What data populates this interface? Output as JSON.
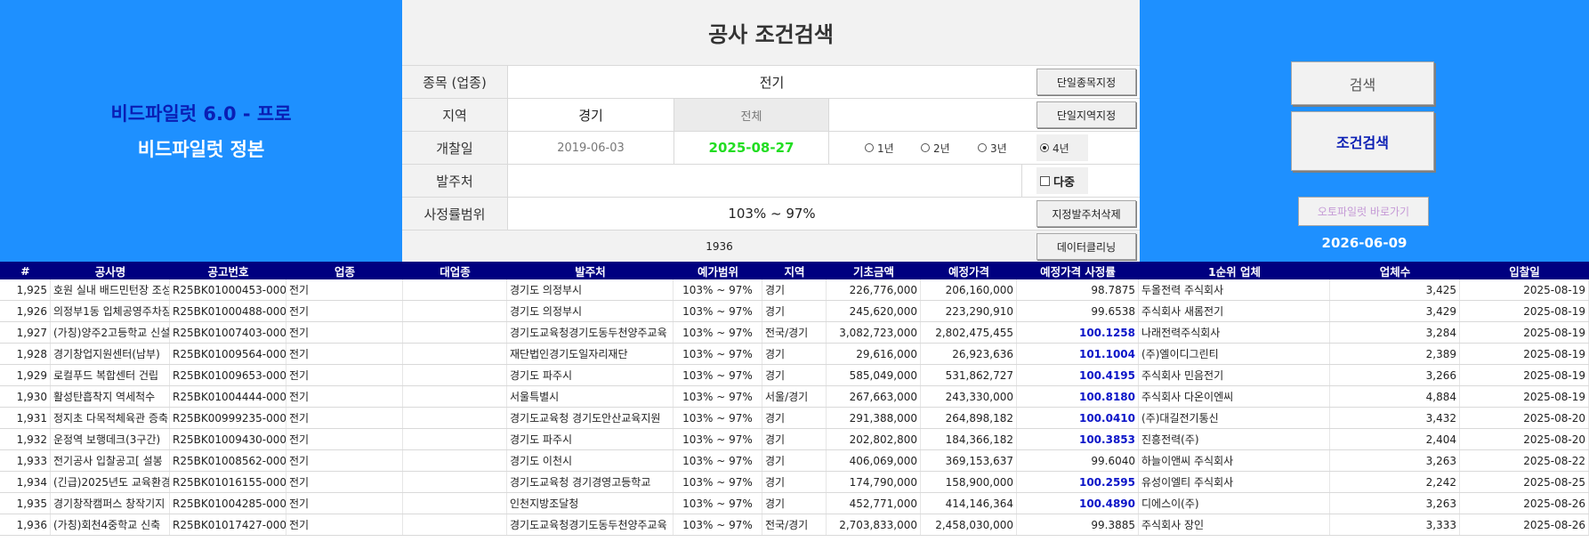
{
  "brand": {
    "line1": "비드파일럿 6.0 - 프로",
    "line2": "비드파일럿 정본"
  },
  "form": {
    "title": "공사 조건검색",
    "labels": {
      "category": "종목 (업종)",
      "region": "지역",
      "date": "개찰일",
      "client": "발주처",
      "range": "사정률범위"
    },
    "category_value": "전기",
    "region_value": "경기",
    "region_sub": "전체",
    "date_from": "2019-06-03",
    "date_to": "2025-08-27",
    "radios": [
      "1년",
      "2년",
      "3년",
      "4년"
    ],
    "radio_selected": "4년",
    "multi_label": "다중",
    "range_value": "103% ~ 97%",
    "count_value": "1936",
    "buttons": {
      "single_category": "단일종목지정",
      "single_region": "단일지역지정",
      "delete_client": "지정발주처삭제",
      "clean_data": "데이터클리닝"
    }
  },
  "right": {
    "search": "검색",
    "cond_search": "조건검색",
    "autopilot": "오토파일럿 바로가기",
    "today": "2026-06-09"
  },
  "colors": {
    "panel_blue": "#1e90ff",
    "header_navy": "#000080",
    "green_date": "#22dd22",
    "brand_dark": "#0a1eb4",
    "rate_blue": "#0b14c8"
  },
  "table": {
    "headers": [
      "#",
      "공사명",
      "공고번호",
      "업종",
      "대업종",
      "발주처",
      "예가범위",
      "지역",
      "기초금액",
      "예정가격",
      "예정가격 사정률",
      "1순위 업체",
      "업체수",
      "입찰일"
    ],
    "rows": [
      [
        "1,925",
        "호원 실내 배드민턴장 조성",
        "R25BK01000453-000",
        "전기",
        "",
        "경기도 의정부시",
        "103% ~ 97%",
        "경기",
        "226,776,000",
        "206,160,000",
        "98.7875",
        "두올전력 주식회사",
        "3,425",
        "2025-08-19"
      ],
      [
        "1,926",
        "의정부1동 입체공영주차장",
        "R25BK01000488-000",
        "전기",
        "",
        "경기도 의정부시",
        "103% ~ 97%",
        "경기",
        "245,620,000",
        "223,290,910",
        "99.6538",
        "주식회사 새롬전기",
        "3,429",
        "2025-08-19"
      ],
      [
        "1,927",
        "(가칭)양주2고등학교 신설",
        "R25BK01007403-000",
        "전기",
        "",
        "경기도교육청경기도동두천양주교육",
        "103% ~ 97%",
        "전국/경기",
        "3,082,723,000",
        "2,802,475,455",
        "100.1258",
        "나래전력주식회사",
        "3,284",
        "2025-08-19"
      ],
      [
        "1,928",
        "경기창업지원센터(남부)",
        "R25BK01009564-000",
        "전기",
        "",
        "재단법인경기도일자리재단",
        "103% ~ 97%",
        "경기",
        "29,616,000",
        "26,923,636",
        "101.1004",
        "(주)엘이디그린티",
        "2,389",
        "2025-08-19"
      ],
      [
        "1,929",
        "로컬푸드 복합센터 건립",
        "R25BK01009653-000",
        "전기",
        "",
        "경기도 파주시",
        "103% ~ 97%",
        "경기",
        "585,049,000",
        "531,862,727",
        "100.4195",
        "주식회사 민음전기",
        "3,266",
        "2025-08-19"
      ],
      [
        "1,930",
        "활성탄흡착지 역세척수",
        "R25BK01004444-000",
        "전기",
        "",
        "서울특별시",
        "103% ~ 97%",
        "서울/경기",
        "267,663,000",
        "243,330,000",
        "100.8180",
        "주식회사 다온이엔씨",
        "4,884",
        "2025-08-19"
      ],
      [
        "1,931",
        "정지초 다목적체육관 증축",
        "R25BK00999235-000",
        "전기",
        "",
        "경기도교육청 경기도안산교육지원",
        "103% ~ 97%",
        "경기",
        "291,388,000",
        "264,898,182",
        "100.0410",
        "(주)대길전기통신",
        "3,432",
        "2025-08-20"
      ],
      [
        "1,932",
        "운정역 보행데크(3구간)",
        "R25BK01009430-000",
        "전기",
        "",
        "경기도 파주시",
        "103% ~ 97%",
        "경기",
        "202,802,800",
        "184,366,182",
        "100.3853",
        "진흥전력(주)",
        "2,404",
        "2025-08-20"
      ],
      [
        "1,933",
        "전기공사 입찰공고[ 설봉",
        "R25BK01008562-000",
        "전기",
        "",
        "경기도 이천시",
        "103% ~ 97%",
        "경기",
        "406,069,000",
        "369,153,637",
        "99.6040",
        "하늘이앤씨 주식회사",
        "3,263",
        "2025-08-22"
      ],
      [
        "1,934",
        "(긴급)2025년도 교육환경",
        "R25BK01016155-000",
        "전기",
        "",
        "경기도교육청 경기경영고등학교",
        "103% ~ 97%",
        "경기",
        "174,790,000",
        "158,900,000",
        "100.2595",
        "유성이엘티 주식회사",
        "2,242",
        "2025-08-25"
      ],
      [
        "1,935",
        "경기창작캠퍼스 창작기지",
        "R25BK01004285-000",
        "전기",
        "",
        "인천지방조달청",
        "103% ~ 97%",
        "경기",
        "452,771,000",
        "414,146,364",
        "100.4890",
        "디에스이(주)",
        "3,263",
        "2025-08-26"
      ],
      [
        "1,936",
        "(가칭)회천4중학교 신축",
        "R25BK01017427-000",
        "전기",
        "",
        "경기도교육청경기도동두천양주교육",
        "103% ~ 97%",
        "전국/경기",
        "2,703,833,000",
        "2,458,030,000",
        "99.3885",
        "주식회사 장인",
        "3,333",
        "2025-08-26"
      ]
    ]
  }
}
